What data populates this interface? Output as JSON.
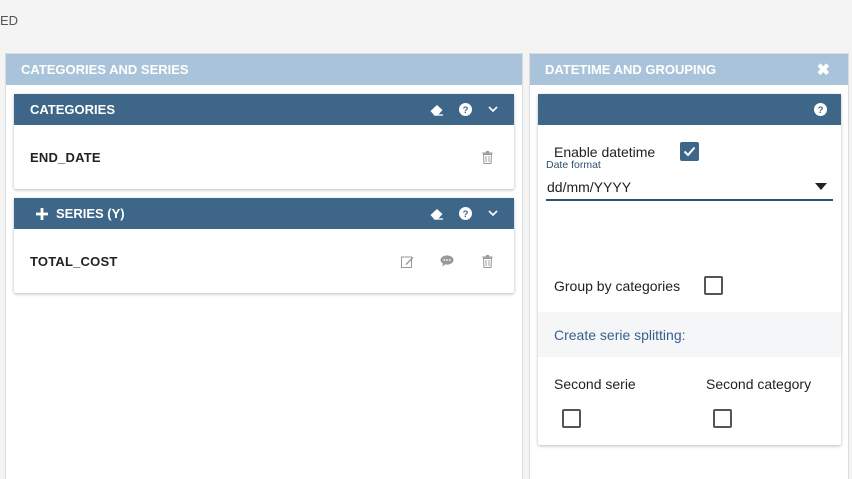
{
  "topbar": {
    "text": "ED"
  },
  "left_panel": {
    "title": "CATEGORIES AND SERIES",
    "categories": {
      "title": "CATEGORIES",
      "items": [
        {
          "name": "END_DATE"
        }
      ]
    },
    "series": {
      "title": "SERIES (Y)",
      "add_icon": "plus-icon",
      "items": [
        {
          "name": "TOTAL_COST"
        }
      ]
    }
  },
  "right_panel": {
    "title": "DATETIME AND GROUPING",
    "close_icon": "close-icon",
    "enable_datetime": {
      "label": "Enable datetime",
      "checked": true
    },
    "date_format": {
      "label": "Date format",
      "value": "dd/mm/YYYY"
    },
    "group_by_categories": {
      "label": "Group by categories",
      "checked": false
    },
    "split_link": "Create serie splitting:",
    "second_serie": {
      "label": "Second serie",
      "checked": false
    },
    "second_category": {
      "label": "Second category",
      "checked": false
    }
  },
  "colors": {
    "panel_header": "#a9c4da",
    "card_header": "#3d6688",
    "accent_text": "#3a5f8f",
    "background": "#f4f4f4"
  }
}
